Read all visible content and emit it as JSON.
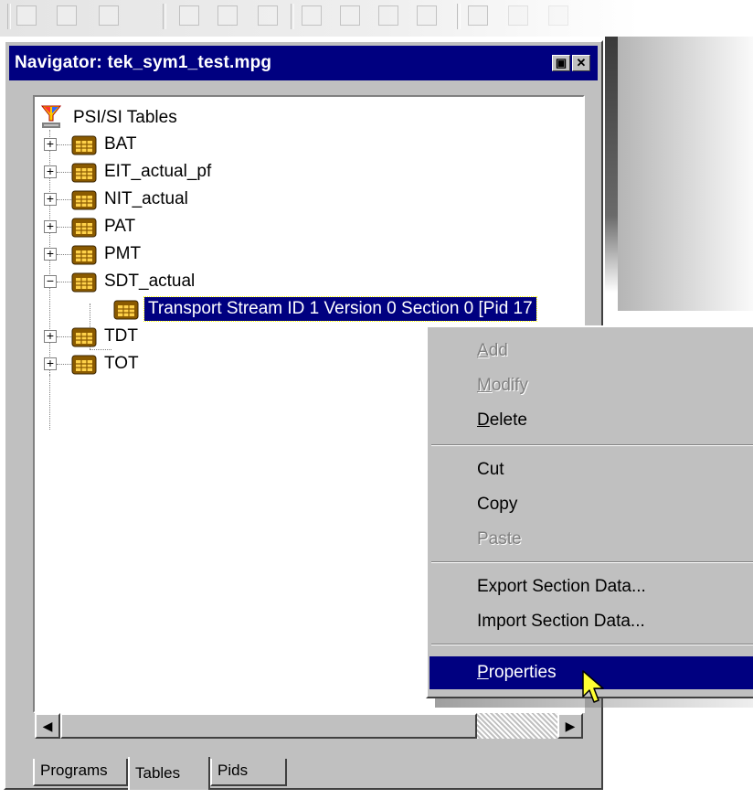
{
  "window": {
    "title": "Navigator: tek_sym1_test.mpg",
    "restore_glyph": "▣",
    "close_glyph": "✕"
  },
  "tree": {
    "root_label": "PSI/SI Tables",
    "nodes": [
      {
        "label": "BAT",
        "expander": "+"
      },
      {
        "label": "EIT_actual_pf",
        "expander": "+"
      },
      {
        "label": "NIT_actual",
        "expander": "+"
      },
      {
        "label": "PAT",
        "expander": "+"
      },
      {
        "label": "PMT",
        "expander": "+"
      },
      {
        "label": "SDT_actual",
        "expander": "−"
      },
      {
        "label": "TDT",
        "expander": "+"
      },
      {
        "label": "TOT",
        "expander": "+"
      }
    ],
    "selected_child": "Transport Stream ID 1 Version 0 Section 0 [Pid 17"
  },
  "scrollbar": {
    "left_arrow": "◀",
    "right_arrow": "▶"
  },
  "tabs": [
    {
      "label": "Programs",
      "active": false
    },
    {
      "label": "Tables",
      "active": true
    },
    {
      "label": "Pids",
      "active": false
    }
  ],
  "context_menu": {
    "add": {
      "mnemonic": "A",
      "rest": "dd"
    },
    "modify": {
      "mnemonic": "M",
      "rest": "odify"
    },
    "delete": {
      "mnemonic": "D",
      "rest": "elete"
    },
    "cut": "Cut",
    "copy": "Copy",
    "paste": "Paste",
    "export": "Export Section Data...",
    "import": "Import Section Data...",
    "properties": {
      "mnemonic": "P",
      "rest": "roperties"
    }
  },
  "colors": {
    "titlebar": "#000080",
    "window_face": "#c0c0c0",
    "selection": "#000080",
    "disabled_text": "#808080"
  },
  "icons": [
    "filter-icon",
    "table-icon",
    "expand-icon",
    "collapse-icon",
    "arrow-cursor-icon"
  ]
}
